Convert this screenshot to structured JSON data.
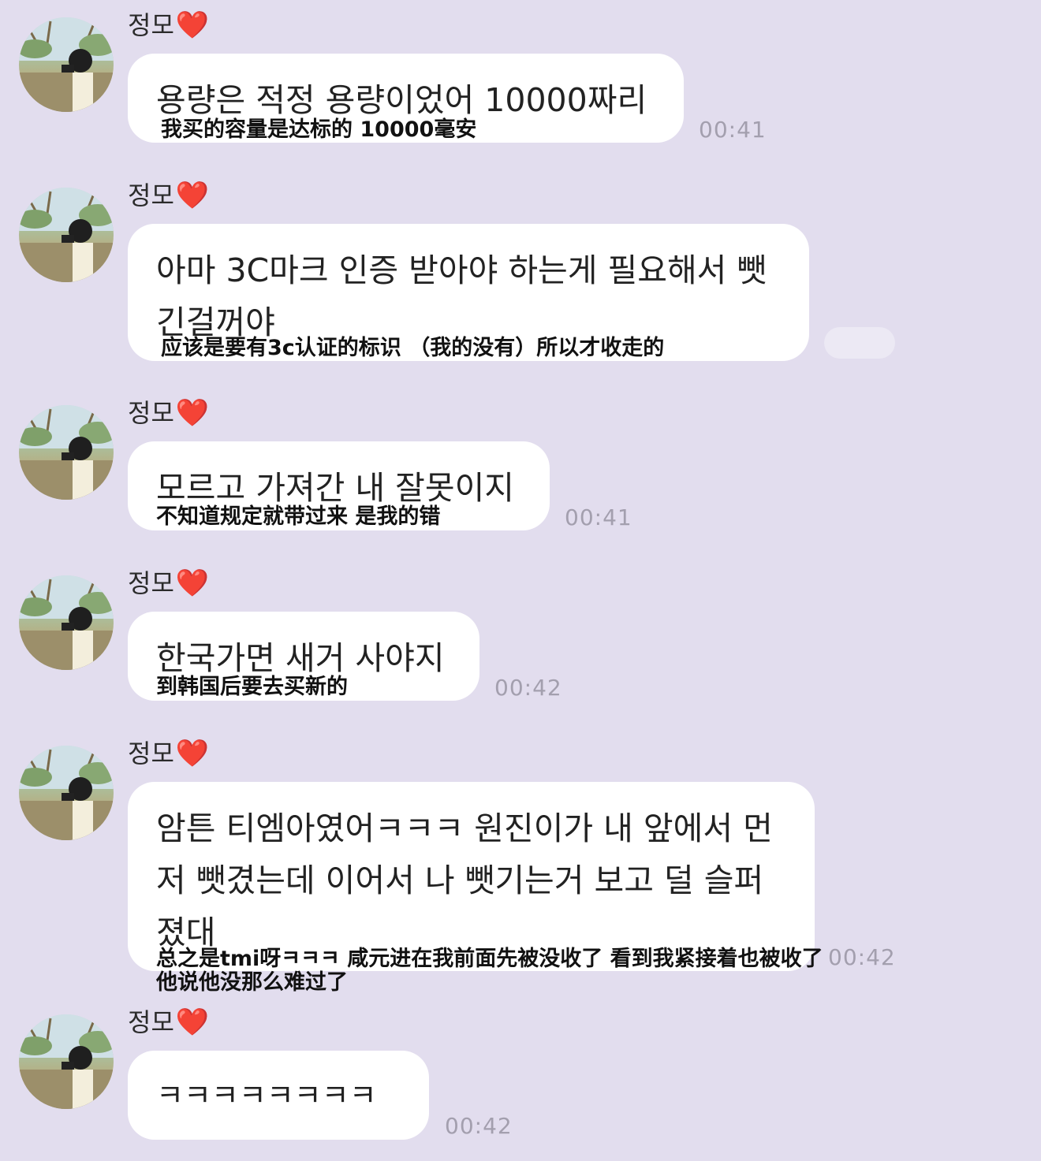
{
  "messages": [
    {
      "sender": "정모",
      "heart": "❤️",
      "text": "용량은 적정 용량이었어 10000짜리",
      "caption": "我买的容量是达标的 10000毫安",
      "time": "00:41"
    },
    {
      "sender": "정모",
      "heart": "❤️",
      "text": "아마 3C마크 인증 받아야 하는게 필요해서 뺏\n긴걸꺼야",
      "caption": "应该是要有3c认证的标识 （我的没有）所以才收走的",
      "time": ""
    },
    {
      "sender": "정모",
      "heart": "❤️",
      "text": "모르고 가져간 내 잘못이지",
      "caption": "不知道规定就带过来 是我的错",
      "time": "00:41"
    },
    {
      "sender": "정모",
      "heart": "❤️",
      "text": "한국가면 새거 사야지",
      "caption": "到韩国后要去买新的",
      "time": "00:42"
    },
    {
      "sender": "정모",
      "heart": "❤️",
      "text": "암튼 티엠아였어ㅋㅋㅋ 원진이가 내 앞에서 먼\n저 뺏겼는데 이어서 나 뺏기는거 보고 덜 슬퍼\n졌대",
      "caption": "总之是tmi呀ㅋㅋㅋ 咸元进在我前面先被没收了 看到我紧接着也被收了",
      "caption2": "他说他没那么难过了",
      "time": "00:42"
    },
    {
      "sender": "정모",
      "heart": "❤️",
      "text": "ㅋㅋㅋㅋㅋㅋㅋㅋ",
      "caption": "",
      "time": "00:42"
    }
  ]
}
